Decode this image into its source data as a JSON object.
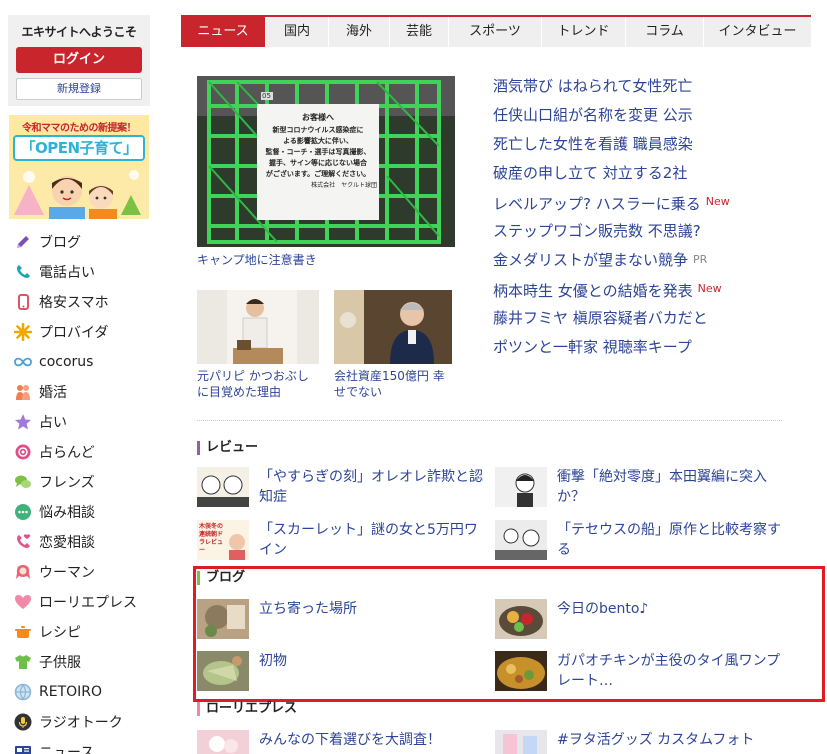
{
  "sidebar": {
    "welcome": "エキサイトへようこそ",
    "login_label": "ログイン",
    "register_label": "新規登録",
    "banner": {
      "line1": "令和ママのための新提案！",
      "line2": "「OPEN子育て」"
    },
    "menu": [
      {
        "label": "ブログ",
        "icon": "pencil-icon",
        "color": "#7a4fb8"
      },
      {
        "label": "電話占い",
        "icon": "phone-icon",
        "color": "#1aa5b5"
      },
      {
        "label": "格安スマホ",
        "icon": "smartphone-icon",
        "color": "#e05566"
      },
      {
        "label": "プロバイダ",
        "icon": "sparkle-icon",
        "color": "#f0a800"
      },
      {
        "label": "cocorus",
        "icon": "infinity-icon",
        "color": "#4aa0d8"
      },
      {
        "label": "婚活",
        "icon": "couple-icon",
        "color": "#f08050"
      },
      {
        "label": "占い",
        "icon": "star-icon",
        "color": "#a07ad8"
      },
      {
        "label": "占らんど",
        "icon": "fortune-icon",
        "color": "#e04d88"
      },
      {
        "label": "フレンズ",
        "icon": "chat-bubbles-icon",
        "color": "#7bc143"
      },
      {
        "label": "悩み相談",
        "icon": "speech-dots-icon",
        "color": "#3db27a"
      },
      {
        "label": "恋愛相談",
        "icon": "heart-phone-icon",
        "color": "#e05588"
      },
      {
        "label": "ウーマン",
        "icon": "woman-icon",
        "color": "#e86478"
      },
      {
        "label": "ローリエプレス",
        "icon": "heart-icon",
        "color": "#f08aa8"
      },
      {
        "label": "レシピ",
        "icon": "pot-icon",
        "color": "#f28a1f"
      },
      {
        "label": "子供服",
        "icon": "tshirt-icon",
        "color": "#6cc04a"
      },
      {
        "label": "RETOIRO",
        "icon": "globe-icon",
        "color": "#8ab6d8"
      },
      {
        "label": "ラジオトーク",
        "icon": "microphone-icon",
        "color": "#333333"
      },
      {
        "label": "ニュース",
        "icon": "newspaper-icon",
        "color": "#2d4598"
      }
    ]
  },
  "tabs": [
    {
      "label": "ニュース",
      "active": true
    },
    {
      "label": "国内",
      "active": false
    },
    {
      "label": "海外",
      "active": false
    },
    {
      "label": "芸能",
      "active": false
    },
    {
      "label": "スポーツ",
      "active": false
    },
    {
      "label": "トレンド",
      "active": false
    },
    {
      "label": "コラム",
      "active": false
    },
    {
      "label": "インタビュー",
      "active": false
    }
  ],
  "featured": {
    "caption": "キャンプ地に注意書き",
    "photo_text": [
      "お客様へ",
      "新型コロナウイルス感染症に",
      "よる影響拡大に伴い、",
      "監督・コーチ・選手は写真撮影、",
      "握手、サイン等に応じない場合",
      "がございます。ご理解ください。",
      "株式会社　ヤクルト球団"
    ],
    "photo_label": "05"
  },
  "headlines": [
    {
      "text": "酒気帯び はねられて女性死亡",
      "badge": ""
    },
    {
      "text": "任侠山口組が名称を変更 公示",
      "badge": ""
    },
    {
      "text": "死亡した女性を看護 職員感染",
      "badge": ""
    },
    {
      "text": "破産の申し立て 対立する2社",
      "badge": ""
    },
    {
      "text": "レベルアップ? ハスラーに乗る",
      "badge": "New"
    },
    {
      "text": "ステップワゴン販売数 不思議?",
      "badge": ""
    },
    {
      "text": "金メダリストが望まない競争",
      "badge": "PR"
    },
    {
      "text": "柄本時生 女優との結婚を発表",
      "badge": "New"
    },
    {
      "text": "藤井フミヤ 槇原容疑者バカだと",
      "badge": ""
    },
    {
      "text": "ポツンと一軒家 視聴率キープ",
      "badge": ""
    }
  ],
  "sub_features": [
    {
      "caption": "元パリピ かつおぶしに目覚めた理由"
    },
    {
      "caption": "会社資産150億円 幸せでない"
    }
  ],
  "sections": {
    "review": {
      "title": "レビュー",
      "articles": [
        {
          "title": "「やすらぎの刻」オレオレ詐欺と認知症"
        },
        {
          "title": "衝撃「絶対零度」本田翼編に突入か？"
        },
        {
          "title": "「スカーレット」謎の女と5万円ワイン"
        },
        {
          "title": "「テセウスの船」原作と比較考察する"
        }
      ],
      "thumb_text": "木俣冬の連続朝ドラレビュー"
    },
    "blog": {
      "title": "ブログ",
      "articles": [
        {
          "title": "立ち寄った場所"
        },
        {
          "title": "今日のbento♪"
        },
        {
          "title": "初物"
        },
        {
          "title": "ガパオチキンが主役のタイ風ワンプレート…"
        }
      ]
    },
    "laurier": {
      "title": "ローリエプレス",
      "articles": [
        {
          "title": "みんなの下着選びを大調査！"
        },
        {
          "title": "#ヲタ活グッズ カスタムフォト"
        }
      ]
    }
  },
  "colors": {
    "accent": "#c9252c",
    "link": "#2d4598",
    "highlight": "#e01b24"
  }
}
